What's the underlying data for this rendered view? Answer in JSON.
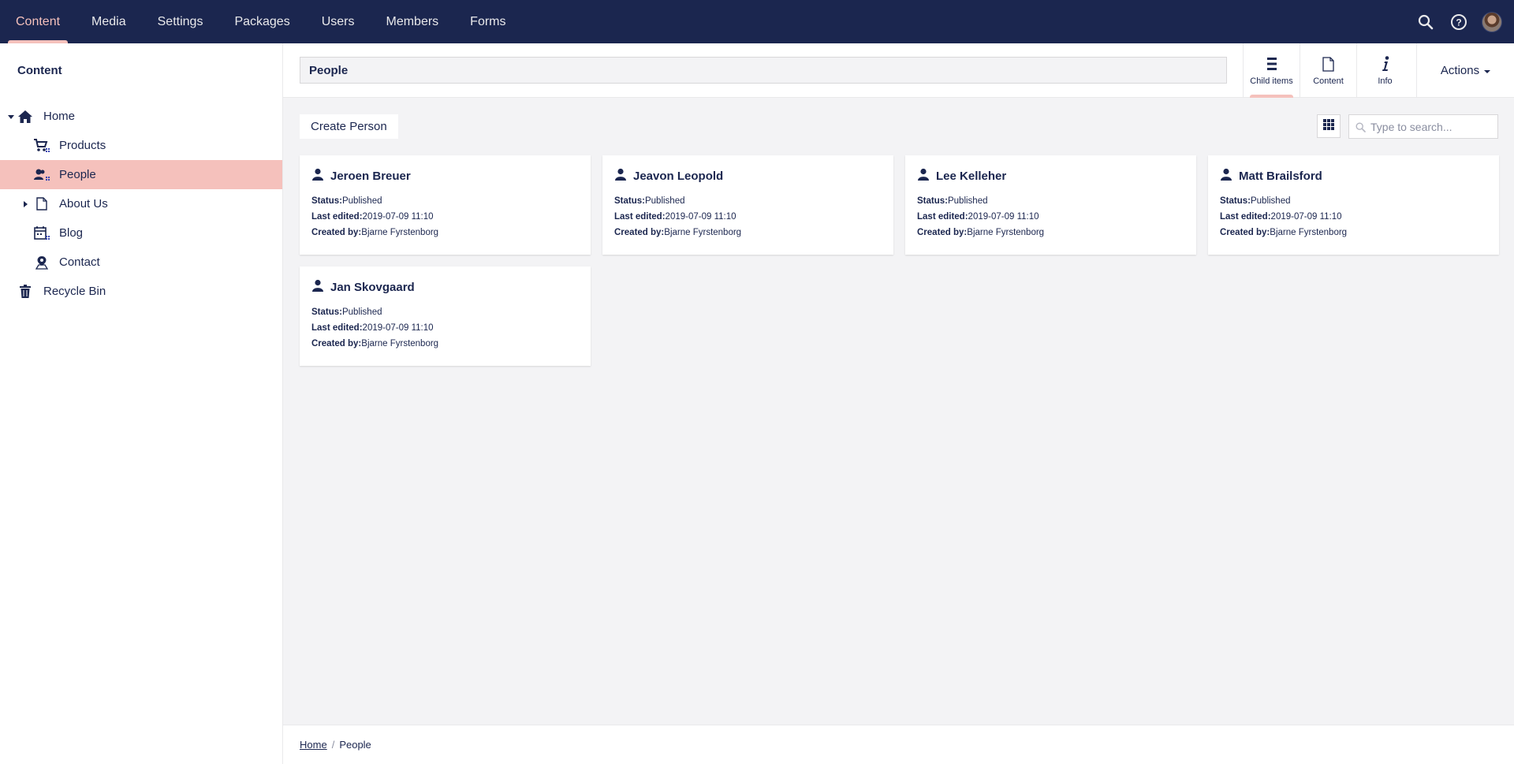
{
  "topnav": {
    "tabs": [
      {
        "label": "Content",
        "active": true
      },
      {
        "label": "Media"
      },
      {
        "label": "Settings"
      },
      {
        "label": "Packages"
      },
      {
        "label": "Users"
      },
      {
        "label": "Members"
      },
      {
        "label": "Forms"
      }
    ],
    "icons": [
      "search-icon",
      "help-icon",
      "user-avatar"
    ]
  },
  "sidebar": {
    "title": "Content",
    "tree": [
      {
        "label": "Home",
        "icon": "home-icon",
        "expanded": true
      },
      {
        "label": "Products",
        "icon": "cart-icon"
      },
      {
        "label": "People",
        "icon": "people-icon",
        "selected": true
      },
      {
        "label": "About Us",
        "icon": "document-icon",
        "collapsed": true
      },
      {
        "label": "Blog",
        "icon": "calendar-icon"
      },
      {
        "label": "Contact",
        "icon": "map-pin-icon"
      },
      {
        "label": "Recycle Bin",
        "icon": "trash-icon"
      }
    ]
  },
  "header": {
    "node_name": "People",
    "apps": [
      {
        "label": "Child items",
        "icon": "list-icon",
        "active": true
      },
      {
        "label": "Content",
        "icon": "document-icon"
      },
      {
        "label": "Info",
        "icon": "info-icon"
      }
    ],
    "actions_label": "Actions"
  },
  "toolbar": {
    "create_label": "Create Person",
    "search_placeholder": "Type to search..."
  },
  "meta_labels": {
    "status": "Status:",
    "last_edited": "Last edited:",
    "created_by": "Created by:"
  },
  "cards": [
    {
      "name": "Jeroen Breuer",
      "status": "Published",
      "last_edited": "2019-07-09 11:10",
      "created_by": "Bjarne Fyrstenborg"
    },
    {
      "name": "Jeavon Leopold",
      "status": "Published",
      "last_edited": "2019-07-09 11:10",
      "created_by": "Bjarne Fyrstenborg"
    },
    {
      "name": "Lee Kelleher",
      "status": "Published",
      "last_edited": "2019-07-09 11:10",
      "created_by": "Bjarne Fyrstenborg"
    },
    {
      "name": "Matt Brailsford",
      "status": "Published",
      "last_edited": "2019-07-09 11:10",
      "created_by": "Bjarne Fyrstenborg"
    },
    {
      "name": "Jan Skovgaard",
      "status": "Published",
      "last_edited": "2019-07-09 11:10",
      "created_by": "Bjarne Fyrstenborg"
    }
  ],
  "breadcrumb": {
    "items": [
      "Home",
      "People"
    ]
  },
  "colors": {
    "navy": "#1b264f",
    "accent_pink": "#f5c1bc",
    "background": "#f3f3f5"
  }
}
